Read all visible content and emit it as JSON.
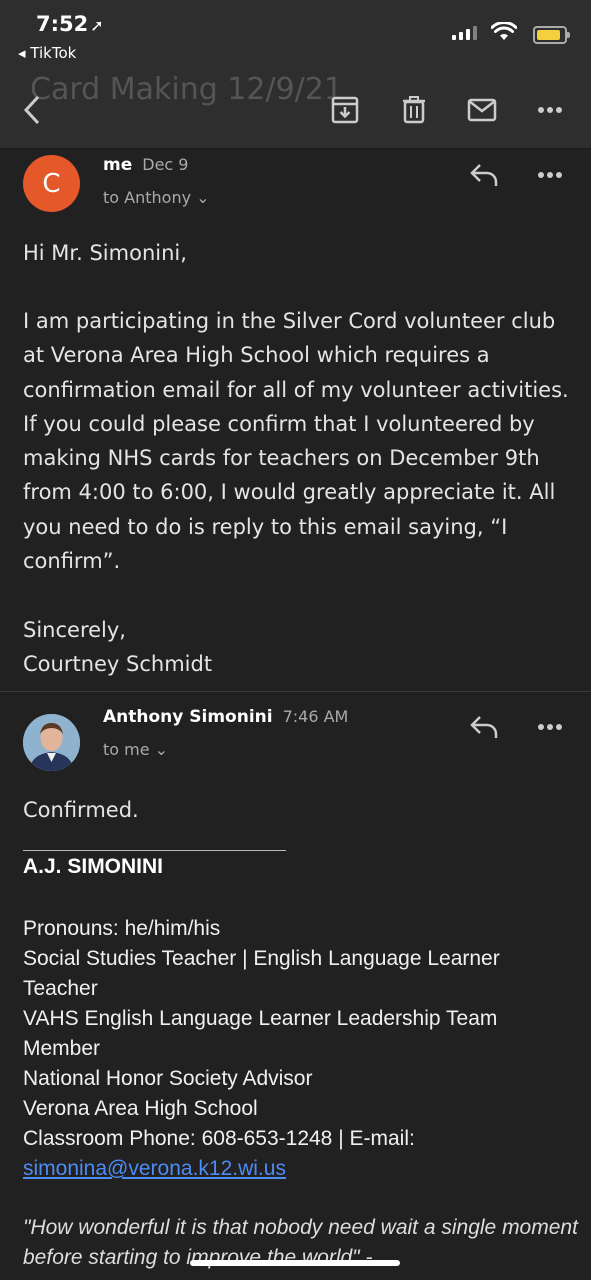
{
  "status": {
    "time": "7:52",
    "back_app": "◂ TikTok"
  },
  "toolbar": {
    "subject": "Card Making 12/9/21",
    "icons": [
      "back-icon",
      "archive-icon",
      "trash-icon",
      "mail-icon",
      "more-icon"
    ]
  },
  "message1": {
    "avatar_letter": "C",
    "sender": "me",
    "date": "Dec 9",
    "to": "to Anthony ⌄",
    "greeting": "Hi Mr. Simonini,",
    "paragraph": "I am participating in the Silver Cord volunteer club at Verona Area High School which requires a confirmation email for all of my volunteer activities. If you could please confirm that I volunteered by making NHS cards for teachers on December 9th from 4:00 to 6:00, I would greatly appreciate it. All you need to do is reply to this email saying, “I confirm”.",
    "closing": "Sincerely,",
    "signature": "Courtney Schmidt"
  },
  "message2": {
    "sender": "Anthony Simonini",
    "date": "7:46 AM",
    "to": "to me ⌄",
    "body": "Confirmed.",
    "sig_name": "A.J. SIMONINI",
    "sig_lines": [
      "Pronouns: he/him/his",
      "Social Studies Teacher | English Language Learner Teacher",
      "VAHS English Language Learner Leadership Team Member",
      "National Honor Society Advisor",
      "Verona Area High School",
      "Classroom Phone: 608-653-1248 | E-mail:"
    ],
    "email": "simonina@verona.k12.wi.us",
    "quote": "\"How wonderful it is that nobody need wait a single moment before starting to improve the world\" -"
  },
  "colors": {
    "background": "#212121",
    "bar": "#2e2e2e",
    "avatar_c": "#e5582a",
    "link": "#4d8bf5"
  }
}
